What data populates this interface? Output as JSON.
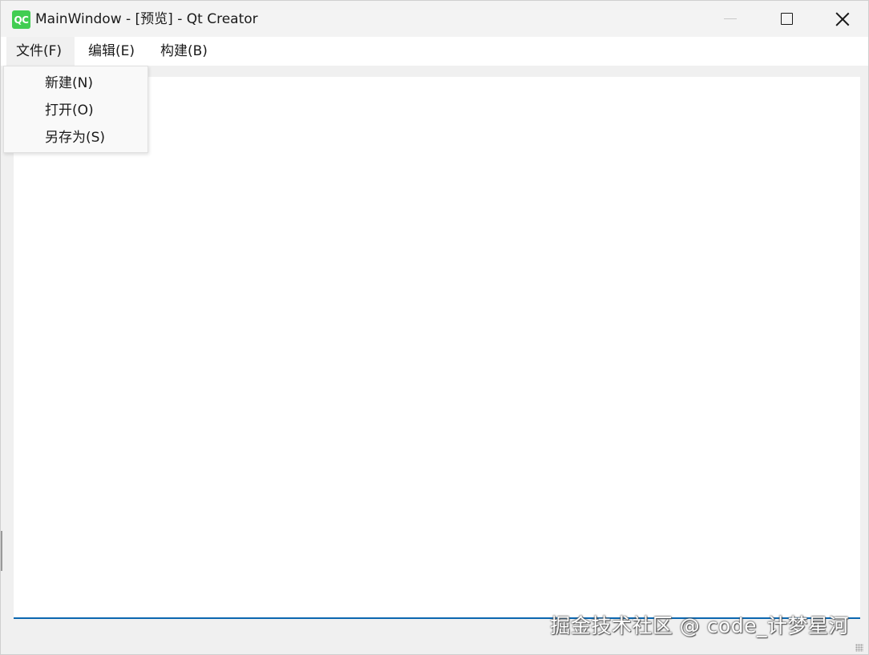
{
  "window": {
    "title": "MainWindow - [预览] - Qt Creator",
    "app_icon_text": "QC",
    "app_icon_color": "#41cd52"
  },
  "menubar": {
    "items": [
      {
        "label": "文件(F)"
      },
      {
        "label": "编辑(E)"
      },
      {
        "label": "构建(B)"
      }
    ]
  },
  "file_menu": {
    "items": [
      {
        "label": "新建(N)"
      },
      {
        "label": "打开(O)"
      },
      {
        "label": "另存为(S)"
      }
    ]
  },
  "statusbar": {
    "accent_color": "#0a66b0"
  },
  "watermark": {
    "text": "掘金技术社区 @ code_计梦星河"
  }
}
